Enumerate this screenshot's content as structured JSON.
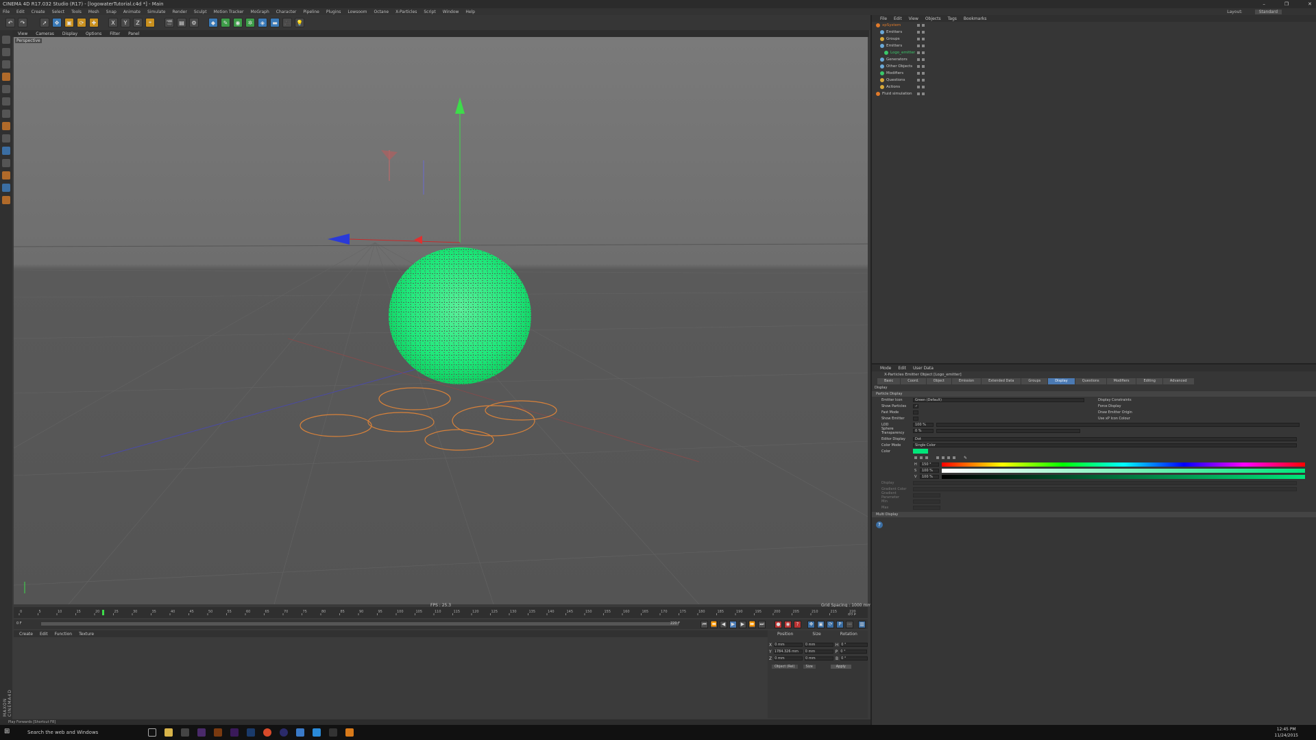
{
  "window": {
    "title": "CINEMA 4D R17.032 Studio (R17) - [logowaterTutorial.c4d *] - Main",
    "controls": [
      "–",
      "❐",
      "✕"
    ]
  },
  "menubar": {
    "items": [
      "File",
      "Edit",
      "Create",
      "Select",
      "Tools",
      "Mesh",
      "Snap",
      "Animate",
      "Simulate",
      "Render",
      "Sculpt",
      "Motion Tracker",
      "MoGraph",
      "Character",
      "Pipeline",
      "Plugins",
      "Lowsoom",
      "Octane",
      "X-Particles",
      "Script",
      "Window",
      "Help"
    ],
    "layout_label": "Layout:",
    "layout_value": "Standard"
  },
  "toolbar": {
    "axis_x": "X",
    "axis_y": "Y",
    "axis_z": "Z"
  },
  "viewport": {
    "menu": [
      "View",
      "Cameras",
      "Display",
      "Options",
      "Filter",
      "Panel"
    ],
    "label": "Perspective",
    "fps": "FPS : 25.3",
    "grid_spacing": "Grid Spacing : 1000 mm",
    "particle_color": "#1ee87a",
    "spline_color": "#d9823a"
  },
  "timeline": {
    "ticks": [
      "0",
      "5",
      "10",
      "15",
      "20",
      "25",
      "30",
      "35",
      "40",
      "45",
      "50",
      "55",
      "60",
      "65",
      "70",
      "75",
      "80",
      "85",
      "90",
      "95",
      "100",
      "105",
      "110",
      "115",
      "120",
      "125",
      "130",
      "135",
      "140",
      "145",
      "150",
      "155",
      "160",
      "165",
      "170",
      "175",
      "180",
      "185",
      "190",
      "195",
      "200",
      "205",
      "210",
      "215",
      "220"
    ],
    "current_frame": "22 F",
    "start": "0 F",
    "end": "220 F",
    "playhead": 0.1
  },
  "material_manager": {
    "menu": [
      "Create",
      "Edit",
      "Function",
      "Texture"
    ]
  },
  "coordinates": {
    "headers": [
      "Position",
      "Size",
      "Rotation"
    ],
    "rows": [
      {
        "axis": "X",
        "pos": "0 mm",
        "size": "0 mm",
        "rot_axis": "H",
        "rot": "0 °"
      },
      {
        "axis": "Y",
        "pos": "1784.326 mm",
        "size": "0 mm",
        "rot_axis": "P",
        "rot": "0 °"
      },
      {
        "axis": "Z",
        "pos": "0 mm",
        "size": "0 mm",
        "rot_axis": "B",
        "rot": "0 °"
      }
    ],
    "mode1": "Object (Rel)",
    "mode2": "Size",
    "apply": "Apply"
  },
  "statusbar": {
    "text": "Play Forwards [Shortcut F8]"
  },
  "object_manager": {
    "menu": [
      "File",
      "Edit",
      "View",
      "Objects",
      "Tags",
      "Bookmarks"
    ],
    "objects": [
      {
        "name": "xpSystem",
        "color": "#e07a2a",
        "indent": 0
      },
      {
        "name": "Emitters",
        "color": "#6aa8d8",
        "indent": 1
      },
      {
        "name": "Groups",
        "color": "#d8a83a",
        "indent": 1
      },
      {
        "name": "Emitters",
        "color": "#6aa8d8",
        "indent": 1
      },
      {
        "name": "Logo_emitter",
        "color": "#3ac86a",
        "indent": 2
      },
      {
        "name": "Generators",
        "color": "#6aa8d8",
        "indent": 1
      },
      {
        "name": "Other Objects",
        "color": "#6aa8d8",
        "indent": 1
      },
      {
        "name": "Modifiers",
        "color": "#3ac86a",
        "indent": 1
      },
      {
        "name": "Questions",
        "color": "#d8a83a",
        "indent": 1
      },
      {
        "name": "Actions",
        "color": "#d8a83a",
        "indent": 1
      },
      {
        "name": "Fluid simulation",
        "color": "#e07a2a",
        "indent": 0
      }
    ]
  },
  "attribute_manager": {
    "menu": [
      "Mode",
      "Edit",
      "User Data"
    ],
    "title": "X-Particles Emitter Object [Logo_emitter]",
    "tabs": [
      "Basic",
      "Coord.",
      "Object",
      "Emission",
      "Extended Data",
      "Groups",
      "Display",
      "Questions",
      "Modifiers",
      "Editing",
      "Advanced"
    ],
    "active_tab": "Display",
    "section": "Display",
    "subsection": "Particle Display",
    "rows": [
      {
        "label": "Emitter Icon",
        "value": "Green (Default)"
      },
      {
        "label": "Show Particles",
        "value": "✓"
      },
      {
        "label": "Fast Mode",
        "value": ""
      },
      {
        "label": "Show Emitter",
        "value": ""
      },
      {
        "label": "LOD",
        "value": "100 %"
      },
      {
        "label": "Sphere Transparency",
        "value": "0 %"
      }
    ],
    "right_checks": [
      "Display Constraints",
      "Force Display",
      "Draw Emitter Origin",
      "Use xP Icon Colour"
    ],
    "editor_display_label": "Editor Display",
    "editor_display_value": "Dot",
    "color_mode_label": "Color Mode",
    "color_mode_value": "Single Color",
    "color_label": "Color",
    "hsv": [
      {
        "ch": "H",
        "val": "150 °"
      },
      {
        "ch": "S",
        "val": "100 %"
      },
      {
        "ch": "V",
        "val": "100 %"
      }
    ],
    "extra_rows": [
      "Display",
      "Gradient Color",
      "Gradient Parameter",
      "Min",
      "Max"
    ],
    "multi_display": "Multi Display",
    "swatch_color": "#00e67a"
  },
  "taskbar": {
    "search": "Search the web and Windows",
    "time": "12:45 PM",
    "date": "11/24/2015"
  },
  "branding": {
    "maxon": "MAXON CINEMA4D"
  }
}
